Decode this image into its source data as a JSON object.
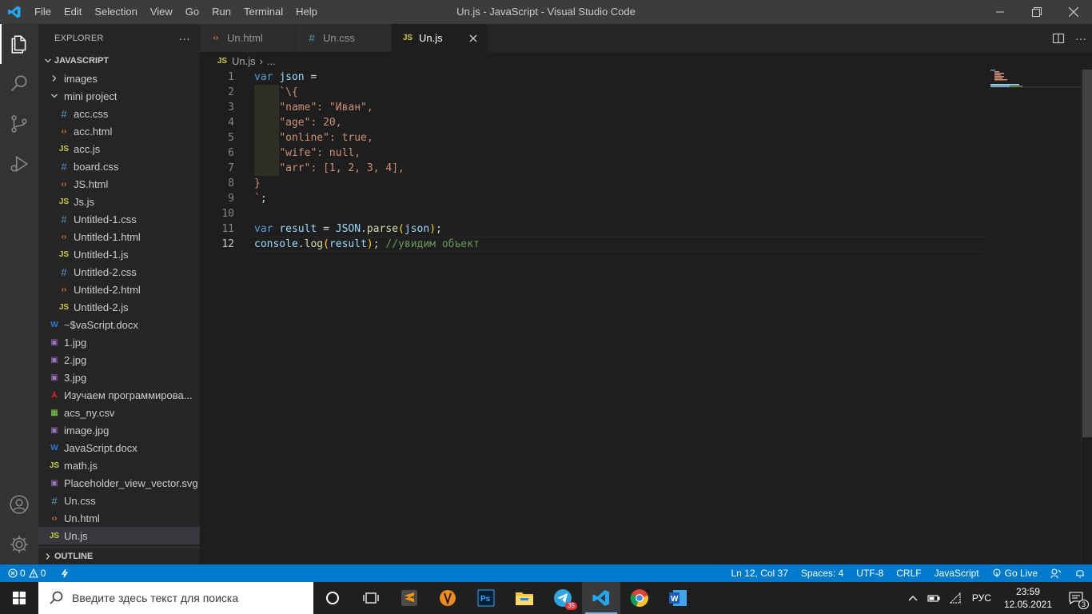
{
  "titlebar": {
    "title": "Un.js - JavaScript - Visual Studio Code",
    "menu": [
      "File",
      "Edit",
      "Selection",
      "View",
      "Go",
      "Run",
      "Terminal",
      "Help"
    ]
  },
  "sidebar": {
    "header": "EXPLORER",
    "more": "···",
    "section": "JAVASCRIPT",
    "items": [
      {
        "label": "images",
        "type": "folder",
        "expanded": false,
        "depth": 1
      },
      {
        "label": "mini project",
        "type": "folder",
        "expanded": true,
        "depth": 1
      },
      {
        "label": "acc.css",
        "type": "css",
        "depth": 2
      },
      {
        "label": "acc.html",
        "type": "html",
        "depth": 2
      },
      {
        "label": "acc.js",
        "type": "js",
        "depth": 2
      },
      {
        "label": "board.css",
        "type": "css",
        "depth": 2
      },
      {
        "label": "JS.html",
        "type": "html",
        "depth": 2
      },
      {
        "label": "Js.js",
        "type": "js",
        "depth": 2
      },
      {
        "label": "Untitled-1.css",
        "type": "css",
        "depth": 2
      },
      {
        "label": "Untitled-1.html",
        "type": "html",
        "depth": 2
      },
      {
        "label": "Untitled-1.js",
        "type": "js",
        "depth": 2
      },
      {
        "label": "Untitled-2.css",
        "type": "css",
        "depth": 2
      },
      {
        "label": "Untitled-2.html",
        "type": "html",
        "depth": 2
      },
      {
        "label": "Untitled-2.js",
        "type": "js",
        "depth": 2
      },
      {
        "label": "~$vaScript.docx",
        "type": "docx",
        "depth": 1
      },
      {
        "label": "1.jpg",
        "type": "jpg",
        "depth": 1
      },
      {
        "label": "2.jpg",
        "type": "jpg",
        "depth": 1
      },
      {
        "label": "3.jpg",
        "type": "jpg",
        "depth": 1
      },
      {
        "label": "Изучаем программирова...",
        "type": "pdf",
        "depth": 1
      },
      {
        "label": "acs_ny.csv",
        "type": "csv",
        "depth": 1
      },
      {
        "label": "image.jpg",
        "type": "jpg",
        "depth": 1
      },
      {
        "label": "JavaScript.docx",
        "type": "docx",
        "depth": 1
      },
      {
        "label": "math.js",
        "type": "js",
        "depth": 1
      },
      {
        "label": "Placeholder_view_vector.svg",
        "type": "svg",
        "depth": 1
      },
      {
        "label": "Un.css",
        "type": "css",
        "depth": 1
      },
      {
        "label": "Un.html",
        "type": "html",
        "depth": 1
      },
      {
        "label": "Un.js",
        "type": "js",
        "depth": 1,
        "selected": true
      }
    ],
    "outline": "OUTLINE"
  },
  "tabs": [
    {
      "label": "Un.html",
      "type": "html",
      "active": false
    },
    {
      "label": "Un.css",
      "type": "css",
      "active": false
    },
    {
      "label": "Un.js",
      "type": "js",
      "active": true
    }
  ],
  "breadcrumbs": {
    "file": "Un.js",
    "sep": "›",
    "rest": "..."
  },
  "editor": {
    "current_line": 12,
    "lines": [
      [
        [
          "kw",
          "var"
        ],
        [
          "punc",
          " "
        ],
        [
          "var",
          "json"
        ],
        [
          "punc",
          " ="
        ]
      ],
      [
        [
          "punc",
          "    "
        ],
        [
          "str",
          "`\\{"
        ]
      ],
      [
        [
          "punc",
          "    "
        ],
        [
          "str",
          "\"name\": \"Иван\","
        ]
      ],
      [
        [
          "punc",
          "    "
        ],
        [
          "str",
          "\"age\": 20,"
        ]
      ],
      [
        [
          "punc",
          "    "
        ],
        [
          "str",
          "\"online\": true,"
        ]
      ],
      [
        [
          "punc",
          "    "
        ],
        [
          "str",
          "\"wife\": null,"
        ]
      ],
      [
        [
          "punc",
          "    "
        ],
        [
          "str",
          "\"arr\": [1, 2, 3, 4],"
        ]
      ],
      [
        [
          "str",
          "}"
        ]
      ],
      [
        [
          "str",
          "`"
        ],
        [
          "punc",
          ";"
        ]
      ],
      [],
      [
        [
          "kw",
          "var"
        ],
        [
          "punc",
          " "
        ],
        [
          "var",
          "result"
        ],
        [
          "punc",
          " = "
        ],
        [
          "var",
          "JSON"
        ],
        [
          "punc",
          "."
        ],
        [
          "fn",
          "parse"
        ],
        [
          "brk",
          "("
        ],
        [
          "var",
          "json"
        ],
        [
          "brk",
          ")"
        ],
        [
          "punc",
          ";"
        ]
      ],
      [
        [
          "var",
          "console"
        ],
        [
          "punc",
          "."
        ],
        [
          "fn",
          "log"
        ],
        [
          "brk",
          "("
        ],
        [
          "var",
          "result"
        ],
        [
          "brk",
          ")"
        ],
        [
          "punc",
          "; "
        ],
        [
          "cm",
          "//увидим объект"
        ]
      ]
    ]
  },
  "statusbar": {
    "errors": "0",
    "warnings": "0",
    "position": "Ln 12, Col 37",
    "spaces": "Spaces: 4",
    "encoding": "UTF-8",
    "eol": "CRLF",
    "language": "JavaScript",
    "golive": "Go Live"
  },
  "taskbar": {
    "search_placeholder": "Введите здесь текст для поиска",
    "lang": "РУС",
    "time": "23:59",
    "date": "12.05.2021",
    "telegram_badge": "35",
    "notifications": "3"
  },
  "colors": {
    "statusbar": "#007acc",
    "activitybar": "#333333",
    "sidebar": "#252526",
    "editor": "#1e1e1e"
  }
}
